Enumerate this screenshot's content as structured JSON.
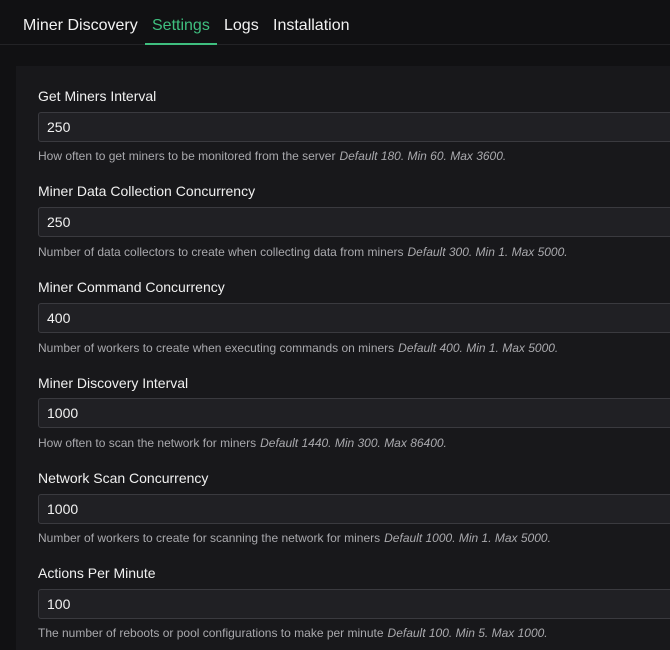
{
  "tabs": [
    {
      "label": "Miner Discovery"
    },
    {
      "label": "Settings"
    },
    {
      "label": "Logs"
    },
    {
      "label": "Installation"
    }
  ],
  "settings": [
    {
      "label": "Get Miners Interval",
      "value": "250",
      "help": "How often to get miners to be monitored from the server",
      "default": "Default 180. Min 60. Max 3600."
    },
    {
      "label": "Miner Data Collection Concurrency",
      "value": "250",
      "help": "Number of data collectors to create when collecting data from miners",
      "default": "Default 300. Min 1. Max 5000."
    },
    {
      "label": "Miner Command Concurrency",
      "value": "400",
      "help": "Number of workers to create when executing commands on miners",
      "default": "Default 400. Min 1. Max 5000."
    },
    {
      "label": "Miner Discovery Interval",
      "value": "1000",
      "help": "How often to scan the network for miners",
      "default": "Default 1440. Min 300. Max 86400."
    },
    {
      "label": "Network Scan Concurrency",
      "value": "1000",
      "help": "Number of workers to create for scanning the network for miners",
      "default": "Default 1000. Min 1. Max 5000."
    },
    {
      "label": "Actions Per Minute",
      "value": "100",
      "help": "The number of reboots or pool configurations to make per minute",
      "default": "Default 100. Min 5. Max 1000."
    }
  ],
  "colors": {
    "accent": "#3fbf7f",
    "background": "#111113",
    "panel": "#18181b",
    "input_bg": "#202024",
    "input_border": "#3a3a3f",
    "help_text": "#a9a9ad"
  }
}
